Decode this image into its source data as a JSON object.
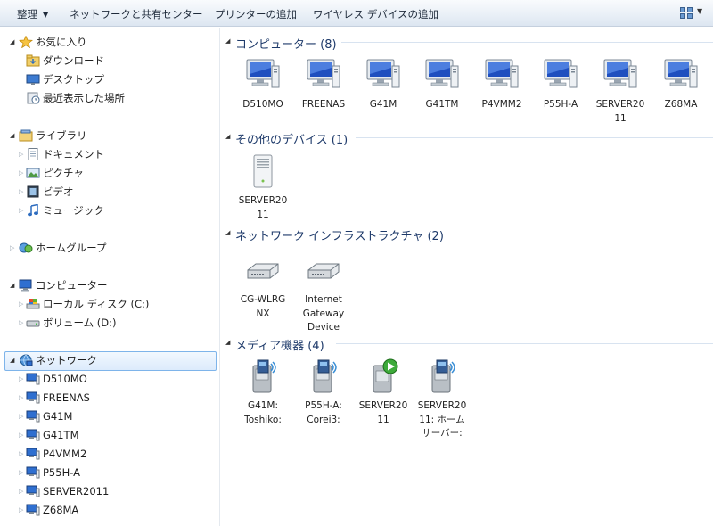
{
  "toolbar": {
    "organize": "整理",
    "network_sharing_center": "ネットワークと共有センター",
    "add_printer": "プリンターの追加",
    "add_wireless_device": "ワイヤレス デバイスの追加"
  },
  "nav": {
    "favorites": {
      "label": "お気に入り",
      "items": [
        "ダウンロード",
        "デスクトップ",
        "最近表示した場所"
      ]
    },
    "libraries": {
      "label": "ライブラリ",
      "items": [
        "ドキュメント",
        "ピクチャ",
        "ビデオ",
        "ミュージック"
      ]
    },
    "homegroup": {
      "label": "ホームグループ"
    },
    "computer": {
      "label": "コンピューター",
      "items": [
        "ローカル ディスク (C:)",
        "ボリューム (D:)"
      ]
    },
    "network": {
      "label": "ネットワーク",
      "items": [
        "D510MO",
        "FREENAS",
        "G41M",
        "G41TM",
        "P4VMM2",
        "P55H-A",
        "SERVER2011",
        "Z68MA"
      ]
    }
  },
  "groups": {
    "computers": {
      "title": "コンピューター (8)",
      "items": [
        "D510MO",
        "FREENAS",
        "G41M",
        "G41TM",
        "P4VMM2",
        "P55H-A",
        "SERVER20\n11",
        "Z68MA"
      ]
    },
    "other_devices": {
      "title": "その他のデバイス (1)",
      "items": [
        "SERVER20\n11"
      ]
    },
    "infrastructure": {
      "title": "ネットワーク インフラストラクチャ (2)",
      "items": [
        "CG-WLRG\nNX",
        "Internet\nGateway\nDevice"
      ]
    },
    "media": {
      "title": "メディア機器 (4)",
      "items": [
        "G41M:\nToshiko:",
        "P55H-A:\nCorei3:",
        "SERVER20\n11",
        "SERVER20\n11: ホーム\nサーバー:"
      ]
    }
  },
  "colors": {
    "selection_border": "#7eb4ea",
    "group_title": "#1e3a6a",
    "toolbar_bg": "#eaf0f7"
  },
  "icons": {
    "computer": "monitor-tower-icon",
    "server": "server-tower-icon",
    "router": "router-icon",
    "media": "media-server-icon"
  }
}
